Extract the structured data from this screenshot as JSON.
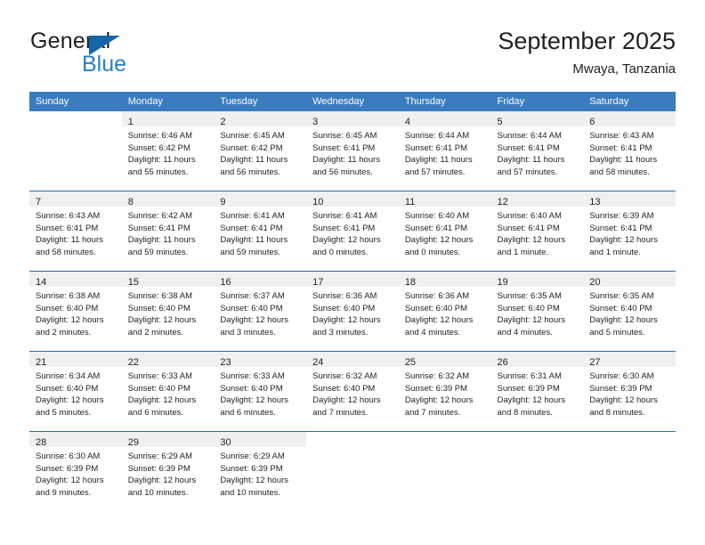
{
  "brand": {
    "name_part1": "General",
    "name_part2": "Blue",
    "accent_color": "#2781c4",
    "triangle_color": "#1565a8"
  },
  "header": {
    "title": "September 2025",
    "subtitle": "Mwaya, Tanzania"
  },
  "theme": {
    "header_row_bg": "#3a7cbe",
    "daynum_band_bg": "#f0f0f0",
    "row_divider": "#2e6da4",
    "text_color": "#231f20"
  },
  "weekday_headers": [
    "Sunday",
    "Monday",
    "Tuesday",
    "Wednesday",
    "Thursday",
    "Friday",
    "Saturday"
  ],
  "weeks": [
    [
      {
        "day": "",
        "lines": []
      },
      {
        "day": "1",
        "lines": [
          "Sunrise: 6:46 AM",
          "Sunset: 6:42 PM",
          "Daylight: 11 hours",
          "and 55 minutes."
        ]
      },
      {
        "day": "2",
        "lines": [
          "Sunrise: 6:45 AM",
          "Sunset: 6:42 PM",
          "Daylight: 11 hours",
          "and 56 minutes."
        ]
      },
      {
        "day": "3",
        "lines": [
          "Sunrise: 6:45 AM",
          "Sunset: 6:41 PM",
          "Daylight: 11 hours",
          "and 56 minutes."
        ]
      },
      {
        "day": "4",
        "lines": [
          "Sunrise: 6:44 AM",
          "Sunset: 6:41 PM",
          "Daylight: 11 hours",
          "and 57 minutes."
        ]
      },
      {
        "day": "5",
        "lines": [
          "Sunrise: 6:44 AM",
          "Sunset: 6:41 PM",
          "Daylight: 11 hours",
          "and 57 minutes."
        ]
      },
      {
        "day": "6",
        "lines": [
          "Sunrise: 6:43 AM",
          "Sunset: 6:41 PM",
          "Daylight: 11 hours",
          "and 58 minutes."
        ]
      }
    ],
    [
      {
        "day": "7",
        "lines": [
          "Sunrise: 6:43 AM",
          "Sunset: 6:41 PM",
          "Daylight: 11 hours",
          "and 58 minutes."
        ]
      },
      {
        "day": "8",
        "lines": [
          "Sunrise: 6:42 AM",
          "Sunset: 6:41 PM",
          "Daylight: 11 hours",
          "and 59 minutes."
        ]
      },
      {
        "day": "9",
        "lines": [
          "Sunrise: 6:41 AM",
          "Sunset: 6:41 PM",
          "Daylight: 11 hours",
          "and 59 minutes."
        ]
      },
      {
        "day": "10",
        "lines": [
          "Sunrise: 6:41 AM",
          "Sunset: 6:41 PM",
          "Daylight: 12 hours",
          "and 0 minutes."
        ]
      },
      {
        "day": "11",
        "lines": [
          "Sunrise: 6:40 AM",
          "Sunset: 6:41 PM",
          "Daylight: 12 hours",
          "and 0 minutes."
        ]
      },
      {
        "day": "12",
        "lines": [
          "Sunrise: 6:40 AM",
          "Sunset: 6:41 PM",
          "Daylight: 12 hours",
          "and 1 minute."
        ]
      },
      {
        "day": "13",
        "lines": [
          "Sunrise: 6:39 AM",
          "Sunset: 6:41 PM",
          "Daylight: 12 hours",
          "and 1 minute."
        ]
      }
    ],
    [
      {
        "day": "14",
        "lines": [
          "Sunrise: 6:38 AM",
          "Sunset: 6:40 PM",
          "Daylight: 12 hours",
          "and 2 minutes."
        ]
      },
      {
        "day": "15",
        "lines": [
          "Sunrise: 6:38 AM",
          "Sunset: 6:40 PM",
          "Daylight: 12 hours",
          "and 2 minutes."
        ]
      },
      {
        "day": "16",
        "lines": [
          "Sunrise: 6:37 AM",
          "Sunset: 6:40 PM",
          "Daylight: 12 hours",
          "and 3 minutes."
        ]
      },
      {
        "day": "17",
        "lines": [
          "Sunrise: 6:36 AM",
          "Sunset: 6:40 PM",
          "Daylight: 12 hours",
          "and 3 minutes."
        ]
      },
      {
        "day": "18",
        "lines": [
          "Sunrise: 6:36 AM",
          "Sunset: 6:40 PM",
          "Daylight: 12 hours",
          "and 4 minutes."
        ]
      },
      {
        "day": "19",
        "lines": [
          "Sunrise: 6:35 AM",
          "Sunset: 6:40 PM",
          "Daylight: 12 hours",
          "and 4 minutes."
        ]
      },
      {
        "day": "20",
        "lines": [
          "Sunrise: 6:35 AM",
          "Sunset: 6:40 PM",
          "Daylight: 12 hours",
          "and 5 minutes."
        ]
      }
    ],
    [
      {
        "day": "21",
        "lines": [
          "Sunrise: 6:34 AM",
          "Sunset: 6:40 PM",
          "Daylight: 12 hours",
          "and 5 minutes."
        ]
      },
      {
        "day": "22",
        "lines": [
          "Sunrise: 6:33 AM",
          "Sunset: 6:40 PM",
          "Daylight: 12 hours",
          "and 6 minutes."
        ]
      },
      {
        "day": "23",
        "lines": [
          "Sunrise: 6:33 AM",
          "Sunset: 6:40 PM",
          "Daylight: 12 hours",
          "and 6 minutes."
        ]
      },
      {
        "day": "24",
        "lines": [
          "Sunrise: 6:32 AM",
          "Sunset: 6:40 PM",
          "Daylight: 12 hours",
          "and 7 minutes."
        ]
      },
      {
        "day": "25",
        "lines": [
          "Sunrise: 6:32 AM",
          "Sunset: 6:39 PM",
          "Daylight: 12 hours",
          "and 7 minutes."
        ]
      },
      {
        "day": "26",
        "lines": [
          "Sunrise: 6:31 AM",
          "Sunset: 6:39 PM",
          "Daylight: 12 hours",
          "and 8 minutes."
        ]
      },
      {
        "day": "27",
        "lines": [
          "Sunrise: 6:30 AM",
          "Sunset: 6:39 PM",
          "Daylight: 12 hours",
          "and 8 minutes."
        ]
      }
    ],
    [
      {
        "day": "28",
        "lines": [
          "Sunrise: 6:30 AM",
          "Sunset: 6:39 PM",
          "Daylight: 12 hours",
          "and 9 minutes."
        ]
      },
      {
        "day": "29",
        "lines": [
          "Sunrise: 6:29 AM",
          "Sunset: 6:39 PM",
          "Daylight: 12 hours",
          "and 10 minutes."
        ]
      },
      {
        "day": "30",
        "lines": [
          "Sunrise: 6:29 AM",
          "Sunset: 6:39 PM",
          "Daylight: 12 hours",
          "and 10 minutes."
        ]
      },
      {
        "day": "",
        "lines": []
      },
      {
        "day": "",
        "lines": []
      },
      {
        "day": "",
        "lines": []
      },
      {
        "day": "",
        "lines": []
      }
    ]
  ]
}
